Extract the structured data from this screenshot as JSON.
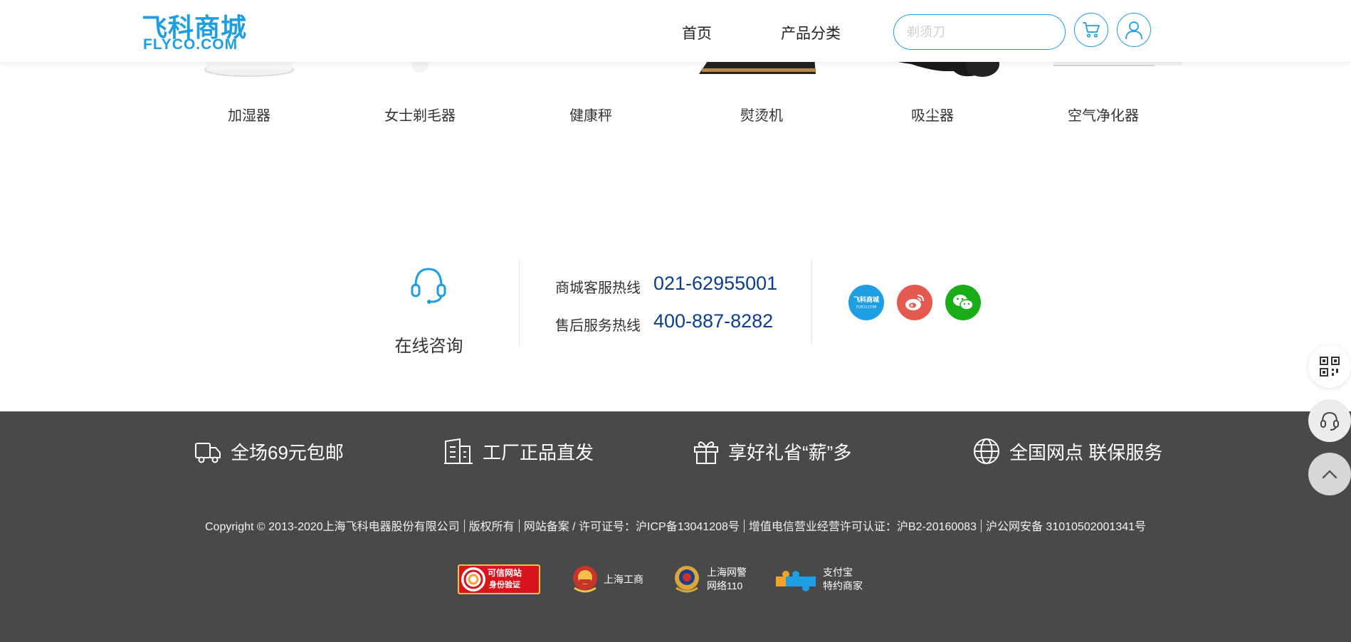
{
  "header": {
    "logo_cn": "飞科商城",
    "logo_en": "FLYCO.COM",
    "nav": [
      "首页",
      "产品分类"
    ],
    "search_placeholder": "剃须刀"
  },
  "products": [
    {
      "name": "加湿器"
    },
    {
      "name": "女士剃毛器"
    },
    {
      "name": "健康秤"
    },
    {
      "name": "熨烫机"
    },
    {
      "name": "吸尘器"
    },
    {
      "name": "空气净化器"
    }
  ],
  "contact": {
    "consult_label": "在线咨询",
    "hotlines": [
      {
        "label": "商城客服热线",
        "number": "021-62955001"
      },
      {
        "label": "售后服务热线",
        "number": "400-887-8282"
      }
    ],
    "social": [
      {
        "name": "flyco",
        "label": "飞科商城",
        "sub": "FLYCO.COM",
        "color": "#1e9ee3"
      },
      {
        "name": "weibo",
        "color": "#e55a4e"
      },
      {
        "name": "wechat",
        "color": "#1aad19"
      }
    ]
  },
  "footer": {
    "features": [
      "全场69元包邮",
      "工厂正品直发",
      "享好礼省“薪”多",
      "全国网点 联保服务"
    ],
    "copyright": [
      "Copyright © 2013-2020上海飞科电器股份有限公司",
      "版权所有",
      "网站备案 / 许可证号：沪ICP备13041208号",
      "增值电信营业经营许可认证：沪B2-20160083",
      "沪公网安备 31010502001341号"
    ],
    "badges": {
      "trusted_line1": "可信网站",
      "trusted_line2": "身份验证",
      "gongshang": "上海工商",
      "police_line1": "上海网警",
      "police_line2": "网络110",
      "alipay_line1": "支付宝",
      "alipay_line2": "特约商家"
    }
  },
  "colors": {
    "brand_blue": "#1e9ee3",
    "hotline_blue": "#0b3d91",
    "footer_bg": "#494949"
  }
}
